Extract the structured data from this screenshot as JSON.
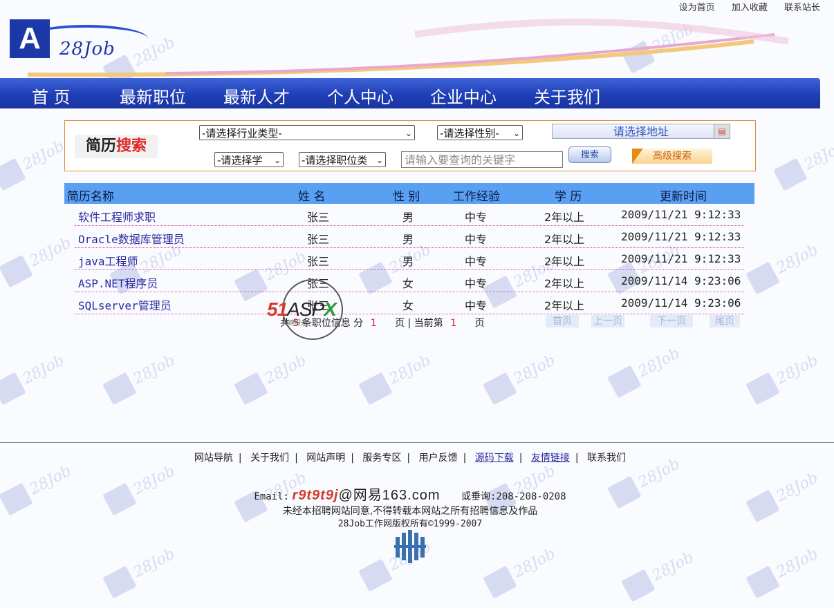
{
  "top_links": [
    "设为首页",
    "加入收藏",
    "联系站长"
  ],
  "logo": {
    "letter": "A",
    "text": "28Job"
  },
  "nav": [
    "首 页",
    "最新职位",
    "最新人才",
    "个人中心",
    "企业中心",
    "关于我们"
  ],
  "search": {
    "title_part1": "简历",
    "title_part2": "搜索",
    "industry": "-请选择行业类型-",
    "gender": "-请选择性别-",
    "address": "请选择地址",
    "education": "-请选择学",
    "position": "-请选择职位类",
    "keyword_placeholder": "请输入要查询的关键字",
    "search_button": "搜索",
    "advanced_button": "高级搜索"
  },
  "table": {
    "headers": [
      "简历名称",
      "姓 名",
      "性 别",
      "工作经验",
      "学 历",
      "更新时间"
    ],
    "rows": [
      {
        "title": "软件工程师求职",
        "name": "张三",
        "gender": "男",
        "edu": "中专",
        "exp": "2年以上",
        "time": "2009/11/21 9:12:33"
      },
      {
        "title": "Oracle数据库管理员",
        "name": "张三",
        "gender": "男",
        "edu": "中专",
        "exp": "2年以上",
        "time": "2009/11/21 9:12:33"
      },
      {
        "title": "java工程师",
        "name": "张三",
        "gender": "男",
        "edu": "中专",
        "exp": "2年以上",
        "time": "2009/11/21 9:12:33"
      },
      {
        "title": "ASP.NET程序员",
        "name": "张三",
        "gender": "女",
        "edu": "中专",
        "exp": "2年以上",
        "time": "2009/11/14 9:23:06"
      },
      {
        "title": "SQLserver管理员",
        "name": "张三",
        "gender": "女",
        "edu": "中专",
        "exp": "2年以上",
        "time": "2009/11/14 9:23:06"
      }
    ]
  },
  "pager": {
    "prefix": "共",
    "count": "5",
    "middle": "条职位信息 分",
    "pages": "1",
    "mid2": "页 | 当前第",
    "current": "1",
    "suffix": "页",
    "buttons": [
      "首页",
      "上一页",
      "下一页",
      "尾页"
    ]
  },
  "stamp": {
    "text_red": "51",
    "text_gray": "ASP",
    "text_green": "X",
    "sub": "快速服务"
  },
  "footer": {
    "links": [
      "网站导航",
      "关于我们",
      "网站声明",
      "服务专区",
      "用户反馈",
      "源码下载",
      "友情链接",
      "联系我们"
    ],
    "email_label": "Email:",
    "email_user": "r9t9t9j",
    "email_domain": "@网易163.com",
    "phone": "或垂询:208-208-0208",
    "notice": "未经本招聘网站同意,不得转载本网站之所有招聘信息及作品",
    "copyright": "28Job工作网版权所有©1999-2007"
  },
  "colors": {
    "nav": "#1f3fb6",
    "header_row": "#5aa0f2",
    "link": "#2b2ba0",
    "accent_red": "#e02828",
    "border_orange": "#e08a3c"
  }
}
